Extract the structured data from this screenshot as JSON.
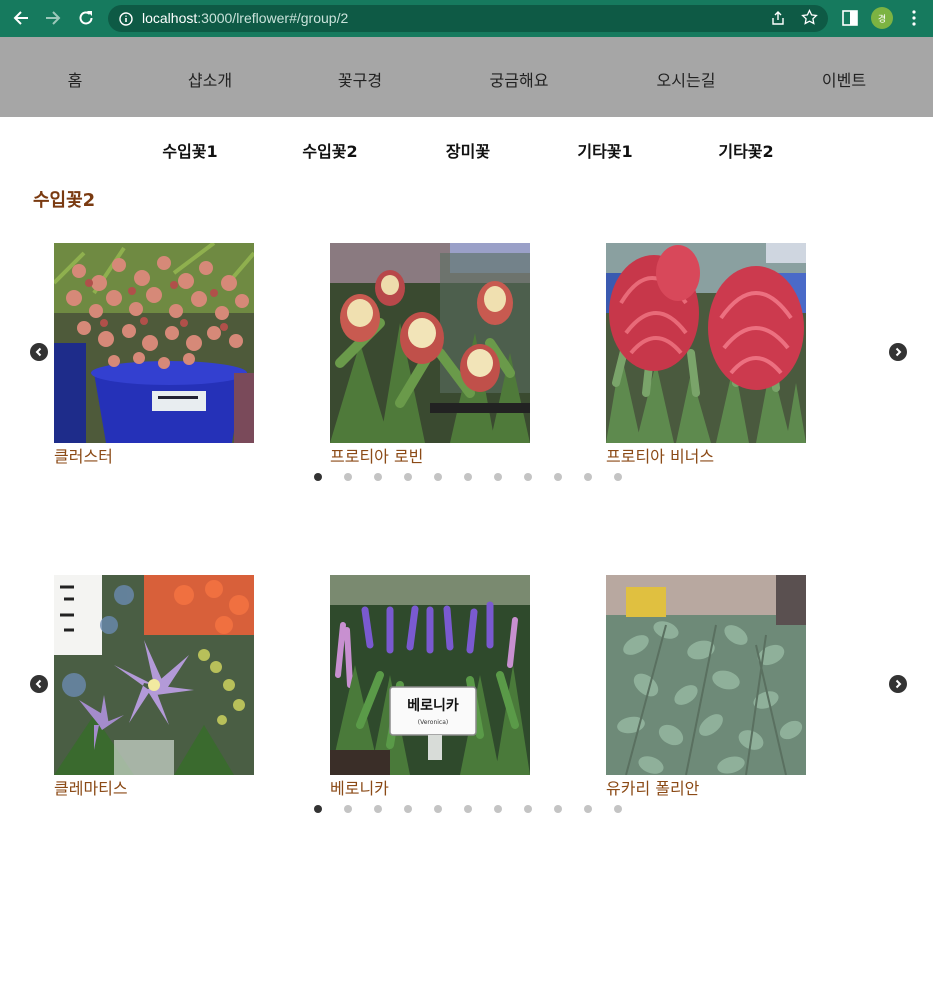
{
  "browser": {
    "url_host": "localhost",
    "url_rest": ":3000/lreflower#/group/2",
    "avatar_initial": "경"
  },
  "main_nav": [
    {
      "label": "홈"
    },
    {
      "label": "샵소개"
    },
    {
      "label": "꽃구경"
    },
    {
      "label": "궁금해요"
    },
    {
      "label": "오시는길"
    },
    {
      "label": "이벤트"
    }
  ],
  "sub_nav": [
    {
      "label": "수입꽃1"
    },
    {
      "label": "수입꽃2"
    },
    {
      "label": "장미꽃"
    },
    {
      "label": "기타꽃1"
    },
    {
      "label": "기타꽃2"
    }
  ],
  "section_title": "수입꽃2",
  "carousels": [
    {
      "cards": [
        {
          "caption": "클러스터",
          "photo": "cluster-flower-photo"
        },
        {
          "caption": "프로티아 로빈",
          "photo": "protea-robin-photo"
        },
        {
          "caption": "프로티아 비너스",
          "photo": "protea-venus-photo"
        }
      ],
      "dot_count": 11,
      "active_dot": 0
    },
    {
      "cards": [
        {
          "caption": "클레마티스",
          "photo": "clematis-photo"
        },
        {
          "caption": "베로니카",
          "photo": "veronica-photo",
          "sign_text": "베로니카",
          "sign_sub": "(Veronica)"
        },
        {
          "caption": "유카리 폴리안",
          "photo": "eucalyptus-polyan-photo"
        }
      ],
      "dot_count": 11,
      "active_dot": 0
    }
  ],
  "colors": {
    "chrome": "#167a5e",
    "nav_bg": "#a6a6a6",
    "title": "#7a3a10",
    "caption": "#8b4a16"
  }
}
